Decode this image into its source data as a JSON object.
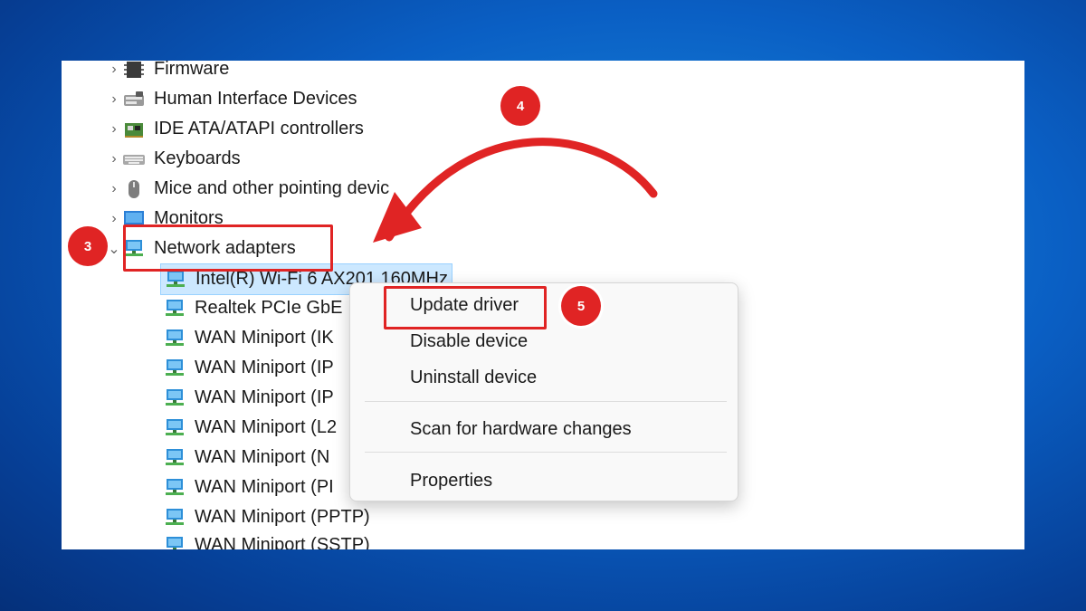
{
  "tree": {
    "categories": [
      {
        "label": "Firmware",
        "icon": "firmware-icon"
      },
      {
        "label": "Human Interface Devices",
        "icon": "hid-icon"
      },
      {
        "label": "IDE ATA/ATAPI controllers",
        "icon": "ide-controller-icon"
      },
      {
        "label": "Keyboards",
        "icon": "keyboard-icon"
      },
      {
        "label": "Mice and other pointing devic",
        "icon": "mouse-icon"
      },
      {
        "label": "Monitors",
        "icon": "monitor-icon"
      },
      {
        "label": "Network adapters",
        "icon": "network-adapter-icon"
      }
    ],
    "adapters": [
      "Intel(R) Wi-Fi 6 AX201 160MHz",
      "Realtek PCIe GbE",
      "WAN Miniport (IK",
      "WAN Miniport (IP",
      "WAN Miniport (IP",
      "WAN Miniport (L2",
      "WAN Miniport (N",
      "WAN Miniport (PI",
      "WAN Miniport (PPTP)",
      "WAN Miniport (SSTP)"
    ]
  },
  "context_menu": {
    "update_driver": "Update driver",
    "disable_device": "Disable device",
    "uninstall_device": "Uninstall device",
    "scan_hardware": "Scan for hardware changes",
    "properties": "Properties"
  },
  "steps": {
    "network_adapters": "3",
    "arrow": "4",
    "update_driver": "5"
  },
  "colors": {
    "accent_red": "#e02424",
    "selection": "#cce8ff",
    "background_blue": "#0a5fc4"
  }
}
